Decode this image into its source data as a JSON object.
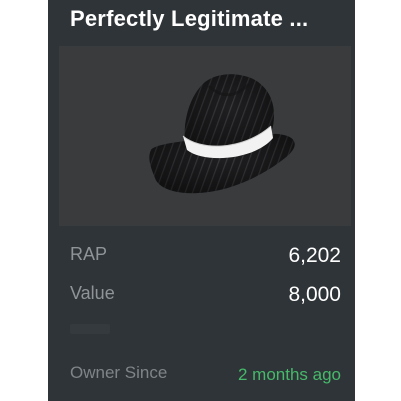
{
  "item": {
    "title": "Perfectly Legitimate ...",
    "thumbnail_icon": "fedora-hat-icon"
  },
  "stats": {
    "rap_label": "RAP",
    "rap_value": "6,202",
    "value_label": "Value",
    "value_value": "8,000",
    "owner_since_label": "Owner Since",
    "owner_since_value": "2 months ago"
  },
  "colors": {
    "card_bg": "#2f3438",
    "thumb_bg": "#393b3d",
    "label_gray": "#8f9499",
    "owner_since_green": "#46b96a"
  }
}
